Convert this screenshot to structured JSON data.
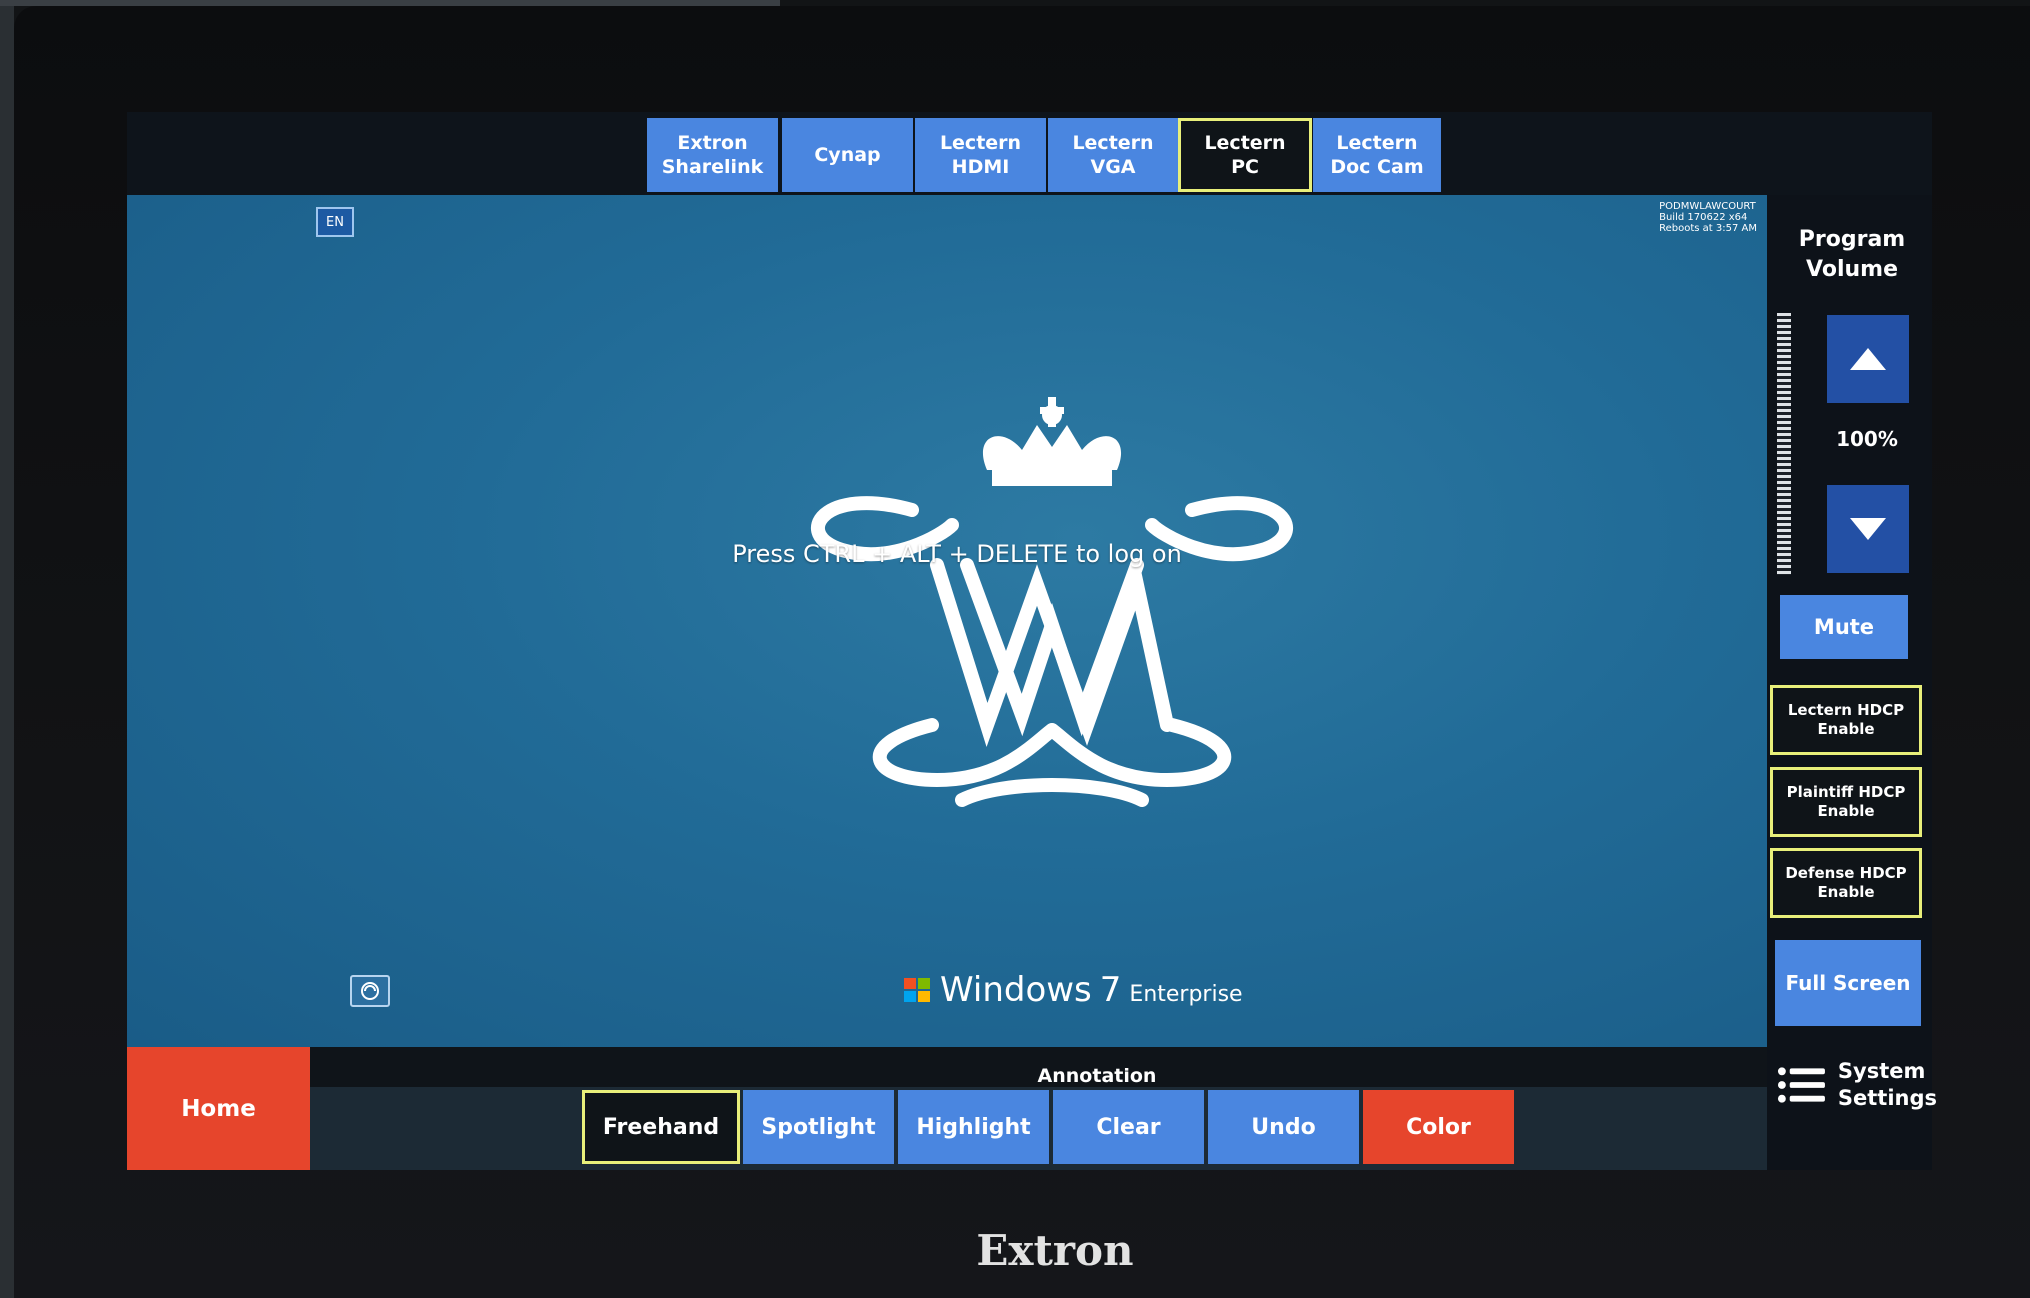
{
  "sources": [
    {
      "label": "Extron\nSharelink",
      "active": false
    },
    {
      "label": "Cynap",
      "active": false
    },
    {
      "label": "Lectern\nHDMI",
      "active": false
    },
    {
      "label": "Lectern\nVGA",
      "active": false
    },
    {
      "label": "Lectern\nPC",
      "active": true
    },
    {
      "label": "Lectern\nDoc Cam",
      "active": false
    }
  ],
  "desktop": {
    "language_indicator": "EN",
    "machine_info": [
      "PODMWLAWCOURT",
      "Build 170622 x64",
      "Reboots at 3:57 AM"
    ],
    "logon_message": "Press CTRL + ALT + DELETE to log on",
    "os_name": "Windows",
    "os_version": "7",
    "os_edition": "Enterprise"
  },
  "volume": {
    "title": "Program\nVolume",
    "level": "100%",
    "mute_label": "Mute"
  },
  "hdcp": [
    "Lectern HDCP\nEnable",
    "Plaintiff HDCP\nEnable",
    "Defense HDCP\nEnable"
  ],
  "full_screen_label": "Full Screen",
  "system_settings_label": "System\nSettings",
  "home_label": "Home",
  "annotation": {
    "title": "Annotation",
    "buttons": [
      {
        "label": "Freehand",
        "active": true
      },
      {
        "label": "Spotlight",
        "active": false
      },
      {
        "label": "Highlight",
        "active": false
      },
      {
        "label": "Clear",
        "active": false
      },
      {
        "label": "Undo",
        "active": false
      },
      {
        "label": "Color",
        "active": false
      }
    ]
  },
  "device_brand": "Extron",
  "colors": {
    "button_blue": "#4a86e0",
    "accent_red": "#e6452c",
    "active_outline": "#e8ef7a",
    "volume_button": "#2350a5",
    "desktop_blue": "#216b97"
  }
}
